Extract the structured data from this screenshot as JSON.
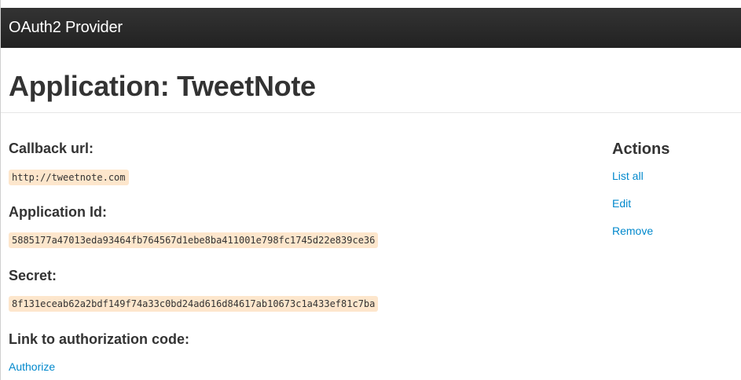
{
  "navbar": {
    "brand": "OAuth2 Provider"
  },
  "header": {
    "title": "Application: TweetNote"
  },
  "fields": {
    "callback_label": "Callback url:",
    "callback_value": "http://tweetnote.com",
    "app_id_label": "Application Id:",
    "app_id_value": "5885177a47013eda93464fb764567d1ebe8ba411001e798fc1745d22e839ce36",
    "secret_label": "Secret:",
    "secret_value": "8f131eceab62a2bdf149f74a33c0bd24ad616d84617ab10673c1a433ef81c7ba",
    "auth_label": "Link to authorization code:",
    "auth_link": "Authorize"
  },
  "sidebar": {
    "title": "Actions",
    "links": [
      "List all",
      "Edit",
      "Remove"
    ]
  },
  "colors": {
    "navbar": "#222222",
    "link": "#0088cc",
    "code_bg": "#fde6cc"
  }
}
